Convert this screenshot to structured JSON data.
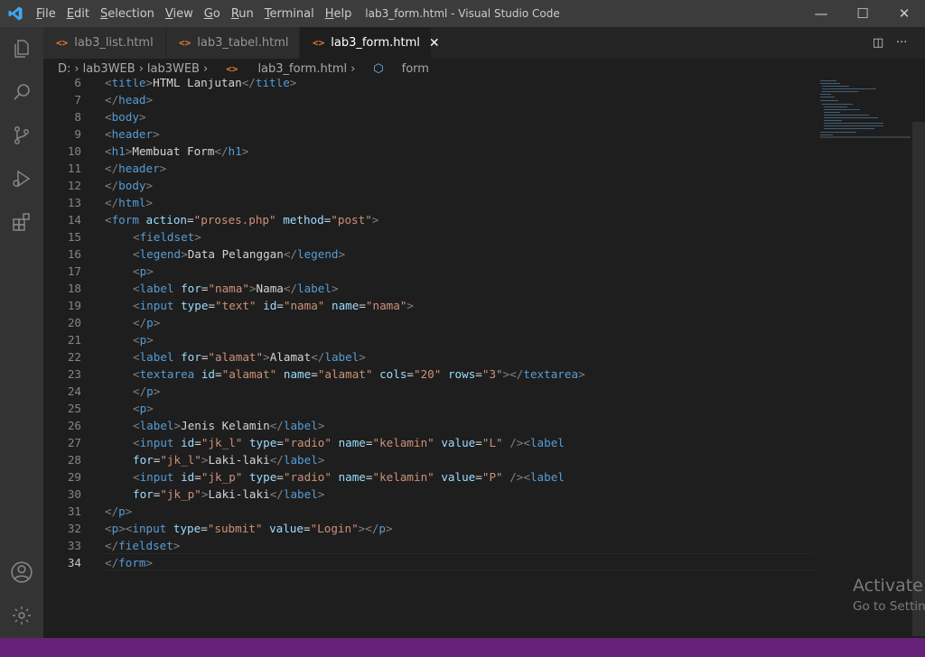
{
  "window": {
    "title": "lab3_form.html - Visual Studio Code",
    "minimize_glyph": "—",
    "maximize_glyph": "☐",
    "close_glyph": "✕"
  },
  "menu": [
    "File",
    "Edit",
    "Selection",
    "View",
    "Go",
    "Run",
    "Terminal",
    "Help"
  ],
  "tabs": [
    {
      "label": "lab3_list.html",
      "icon": "<>",
      "active": false
    },
    {
      "label": "lab3_tabel.html",
      "icon": "<>",
      "active": false
    },
    {
      "label": "lab3_form.html",
      "icon": "<>",
      "active": true,
      "close": "✕"
    }
  ],
  "editor_actions": {
    "split": "◫",
    "more": "···"
  },
  "breadcrumb": {
    "drive": "D:",
    "folder1": "lab3WEB",
    "folder2": "lab3WEB",
    "file": "lab3_form.html",
    "symbol": "form",
    "sep": "›"
  },
  "code_lines": [
    {
      "n": "6",
      "parts": [
        [
          "br",
          "<"
        ],
        [
          "tag",
          "title"
        ],
        [
          "br",
          ">"
        ],
        [
          "txt",
          "HTML Lanjutan"
        ],
        [
          "br",
          "</"
        ],
        [
          "tag",
          "title"
        ],
        [
          "br",
          ">"
        ]
      ]
    },
    {
      "n": "7",
      "parts": [
        [
          "br",
          "</"
        ],
        [
          "tag",
          "head"
        ],
        [
          "br",
          ">"
        ]
      ]
    },
    {
      "n": "8",
      "parts": [
        [
          "br",
          "<"
        ],
        [
          "tag",
          "body"
        ],
        [
          "br",
          ">"
        ]
      ]
    },
    {
      "n": "9",
      "parts": [
        [
          "br",
          "<"
        ],
        [
          "tag",
          "header"
        ],
        [
          "br",
          ">"
        ]
      ]
    },
    {
      "n": "10",
      "parts": [
        [
          "br",
          "<"
        ],
        [
          "tag",
          "h1"
        ],
        [
          "br",
          ">"
        ],
        [
          "txt",
          "Membuat Form"
        ],
        [
          "br",
          "</"
        ],
        [
          "tag",
          "h1"
        ],
        [
          "br",
          ">"
        ]
      ]
    },
    {
      "n": "11",
      "parts": [
        [
          "br",
          "</"
        ],
        [
          "tag",
          "header"
        ],
        [
          "br",
          ">"
        ]
      ]
    },
    {
      "n": "12",
      "parts": [
        [
          "br",
          "</"
        ],
        [
          "tag",
          "body"
        ],
        [
          "br",
          ">"
        ]
      ]
    },
    {
      "n": "13",
      "parts": [
        [
          "br",
          "</"
        ],
        [
          "tag",
          "html"
        ],
        [
          "br",
          ">"
        ]
      ]
    },
    {
      "n": "14",
      "parts": [
        [
          "br",
          "<"
        ],
        [
          "tag",
          "form "
        ],
        [
          "attr",
          "action"
        ],
        [
          "txt",
          "="
        ],
        [
          "str",
          "\"proses.php\""
        ],
        [
          "txt",
          " "
        ],
        [
          "attr",
          "method"
        ],
        [
          "txt",
          "="
        ],
        [
          "str",
          "\"post\""
        ],
        [
          "br",
          ">"
        ]
      ]
    },
    {
      "n": "15",
      "indent": true,
      "parts": [
        [
          "br",
          "<"
        ],
        [
          "tag",
          "fieldset"
        ],
        [
          "br",
          ">"
        ]
      ]
    },
    {
      "n": "16",
      "indent": true,
      "parts": [
        [
          "br",
          "<"
        ],
        [
          "tag",
          "legend"
        ],
        [
          "br",
          ">"
        ],
        [
          "txt",
          "Data Pelanggan"
        ],
        [
          "br",
          "</"
        ],
        [
          "tag",
          "legend"
        ],
        [
          "br",
          ">"
        ]
      ]
    },
    {
      "n": "17",
      "indent": true,
      "parts": [
        [
          "br",
          "<"
        ],
        [
          "tag",
          "p"
        ],
        [
          "br",
          ">"
        ]
      ]
    },
    {
      "n": "18",
      "indent": true,
      "parts": [
        [
          "br",
          "<"
        ],
        [
          "tag",
          "label "
        ],
        [
          "attr",
          "for"
        ],
        [
          "txt",
          "="
        ],
        [
          "str",
          "\"nama\""
        ],
        [
          "br",
          ">"
        ],
        [
          "txt",
          "Nama"
        ],
        [
          "br",
          "</"
        ],
        [
          "tag",
          "label"
        ],
        [
          "br",
          ">"
        ]
      ]
    },
    {
      "n": "19",
      "indent": true,
      "parts": [
        [
          "br",
          "<"
        ],
        [
          "tag",
          "input "
        ],
        [
          "attr",
          "type"
        ],
        [
          "txt",
          "="
        ],
        [
          "str",
          "\"text\""
        ],
        [
          "txt",
          " "
        ],
        [
          "attr",
          "id"
        ],
        [
          "txt",
          "="
        ],
        [
          "str",
          "\"nama\""
        ],
        [
          "txt",
          " "
        ],
        [
          "attr",
          "name"
        ],
        [
          "txt",
          "="
        ],
        [
          "str",
          "\"nama\""
        ],
        [
          "br",
          ">"
        ]
      ]
    },
    {
      "n": "20",
      "indent": true,
      "parts": [
        [
          "br",
          "</"
        ],
        [
          "tag",
          "p"
        ],
        [
          "br",
          ">"
        ]
      ]
    },
    {
      "n": "21",
      "indent": true,
      "parts": [
        [
          "br",
          "<"
        ],
        [
          "tag",
          "p"
        ],
        [
          "br",
          ">"
        ]
      ]
    },
    {
      "n": "22",
      "indent": true,
      "parts": [
        [
          "br",
          "<"
        ],
        [
          "tag",
          "label "
        ],
        [
          "attr",
          "for"
        ],
        [
          "txt",
          "="
        ],
        [
          "str",
          "\"alamat\""
        ],
        [
          "br",
          ">"
        ],
        [
          "txt",
          "Alamat"
        ],
        [
          "br",
          "</"
        ],
        [
          "tag",
          "label"
        ],
        [
          "br",
          ">"
        ]
      ]
    },
    {
      "n": "23",
      "indent": true,
      "parts": [
        [
          "br",
          "<"
        ],
        [
          "tag",
          "textarea "
        ],
        [
          "attr",
          "id"
        ],
        [
          "txt",
          "="
        ],
        [
          "str",
          "\"alamat\""
        ],
        [
          "txt",
          " "
        ],
        [
          "attr",
          "name"
        ],
        [
          "txt",
          "="
        ],
        [
          "str",
          "\"alamat\""
        ],
        [
          "txt",
          " "
        ],
        [
          "attr",
          "cols"
        ],
        [
          "txt",
          "="
        ],
        [
          "str",
          "\"20\""
        ],
        [
          "txt",
          " "
        ],
        [
          "attr",
          "rows"
        ],
        [
          "txt",
          "="
        ],
        [
          "str",
          "\"3\""
        ],
        [
          "br",
          "></"
        ],
        [
          "tag",
          "textarea"
        ],
        [
          "br",
          ">"
        ]
      ]
    },
    {
      "n": "24",
      "indent": true,
      "parts": [
        [
          "br",
          "</"
        ],
        [
          "tag",
          "p"
        ],
        [
          "br",
          ">"
        ]
      ]
    },
    {
      "n": "25",
      "indent": true,
      "parts": [
        [
          "br",
          "<"
        ],
        [
          "tag",
          "p"
        ],
        [
          "br",
          ">"
        ]
      ]
    },
    {
      "n": "26",
      "indent": true,
      "parts": [
        [
          "br",
          "<"
        ],
        [
          "tag",
          "label"
        ],
        [
          "br",
          ">"
        ],
        [
          "txt",
          "Jenis Kelamin"
        ],
        [
          "br",
          "</"
        ],
        [
          "tag",
          "label"
        ],
        [
          "br",
          ">"
        ]
      ]
    },
    {
      "n": "27",
      "indent": true,
      "parts": [
        [
          "br",
          "<"
        ],
        [
          "tag",
          "input "
        ],
        [
          "attr",
          "id"
        ],
        [
          "txt",
          "="
        ],
        [
          "str",
          "\"jk_l\""
        ],
        [
          "txt",
          " "
        ],
        [
          "attr",
          "type"
        ],
        [
          "txt",
          "="
        ],
        [
          "str",
          "\"radio\""
        ],
        [
          "txt",
          " "
        ],
        [
          "attr",
          "name"
        ],
        [
          "txt",
          "="
        ],
        [
          "str",
          "\"kelamin\""
        ],
        [
          "txt",
          " "
        ],
        [
          "attr",
          "value"
        ],
        [
          "txt",
          "="
        ],
        [
          "str",
          "\"L\""
        ],
        [
          "txt",
          " "
        ],
        [
          "br",
          "/><"
        ],
        [
          "tag",
          "label"
        ]
      ]
    },
    {
      "n": "28",
      "indent": true,
      "parts": [
        [
          "attr",
          "for"
        ],
        [
          "txt",
          "="
        ],
        [
          "str",
          "\"jk_l\""
        ],
        [
          "br",
          ">"
        ],
        [
          "txt",
          "Laki-laki"
        ],
        [
          "br",
          "</"
        ],
        [
          "tag",
          "label"
        ],
        [
          "br",
          ">"
        ]
      ]
    },
    {
      "n": "29",
      "indent": true,
      "parts": [
        [
          "br",
          "<"
        ],
        [
          "tag",
          "input "
        ],
        [
          "attr",
          "id"
        ],
        [
          "txt",
          "="
        ],
        [
          "str",
          "\"jk_p\""
        ],
        [
          "txt",
          " "
        ],
        [
          "attr",
          "type"
        ],
        [
          "txt",
          "="
        ],
        [
          "str",
          "\"radio\""
        ],
        [
          "txt",
          " "
        ],
        [
          "attr",
          "name"
        ],
        [
          "txt",
          "="
        ],
        [
          "str",
          "\"kelamin\""
        ],
        [
          "txt",
          " "
        ],
        [
          "attr",
          "value"
        ],
        [
          "txt",
          "="
        ],
        [
          "str",
          "\"P\""
        ],
        [
          "txt",
          " "
        ],
        [
          "br",
          "/><"
        ],
        [
          "tag",
          "label"
        ]
      ]
    },
    {
      "n": "30",
      "indent": true,
      "parts": [
        [
          "attr",
          "for"
        ],
        [
          "txt",
          "="
        ],
        [
          "str",
          "\"jk_p\""
        ],
        [
          "br",
          ">"
        ],
        [
          "txt",
          "Laki-laki"
        ],
        [
          "br",
          "</"
        ],
        [
          "tag",
          "label"
        ],
        [
          "br",
          ">"
        ]
      ]
    },
    {
      "n": "31",
      "parts": [
        [
          "br",
          "</"
        ],
        [
          "tag",
          "p"
        ],
        [
          "br",
          ">"
        ]
      ]
    },
    {
      "n": "32",
      "parts": [
        [
          "br",
          "<"
        ],
        [
          "tag",
          "p"
        ],
        [
          "br",
          "><"
        ],
        [
          "tag",
          "input "
        ],
        [
          "attr",
          "type"
        ],
        [
          "txt",
          "="
        ],
        [
          "str",
          "\"submit\""
        ],
        [
          "txt",
          " "
        ],
        [
          "attr",
          "value"
        ],
        [
          "txt",
          "="
        ],
        [
          "str",
          "\"Login\""
        ],
        [
          "br",
          "></"
        ],
        [
          "tag",
          "p"
        ],
        [
          "br",
          ">"
        ]
      ]
    },
    {
      "n": "33",
      "parts": [
        [
          "br",
          "</"
        ],
        [
          "tag",
          "fieldset"
        ],
        [
          "br",
          ">"
        ]
      ]
    },
    {
      "n": "34",
      "current": true,
      "parts": [
        [
          "br",
          "</"
        ],
        [
          "tag",
          "form"
        ],
        [
          "br",
          ">"
        ]
      ]
    }
  ],
  "watermark": {
    "line1": "Activate W",
    "line2": "Go to Settin"
  },
  "colors": {
    "titlebar": "#3c3c3c",
    "activitybar": "#333333",
    "editor_bg": "#1e1e1e",
    "tag": "#569cd6",
    "attr": "#9cdcfe",
    "string": "#ce9178",
    "statusbar": "#68217a"
  }
}
